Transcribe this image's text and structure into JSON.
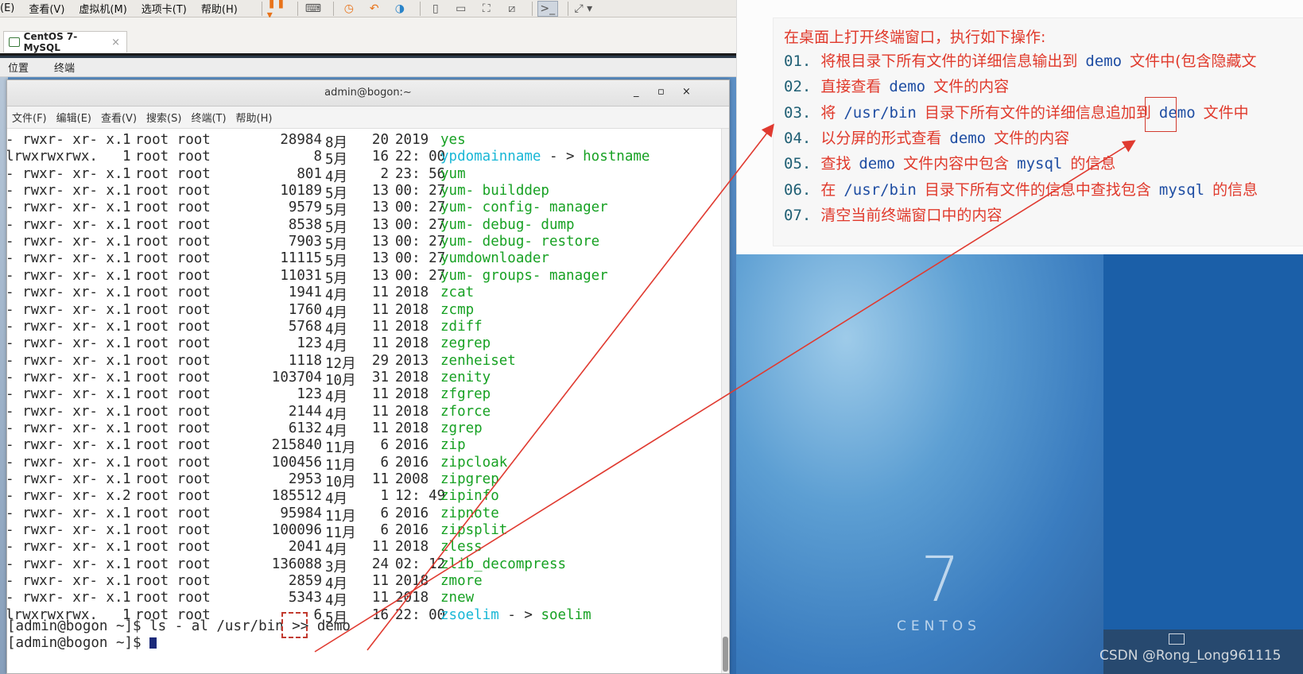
{
  "vmware": {
    "menu": [
      "(E)",
      "查看(V)",
      "虚拟机(M)",
      "选项卡(T)",
      "帮助(H)"
    ],
    "tab_label": "CentOS 7-MySQL",
    "tab_close": "×"
  },
  "guest_panel": {
    "places": "位置",
    "terminal": "终端"
  },
  "terminal": {
    "title": "admin@bogon:~",
    "btn_min": "_",
    "btn_max": "▫",
    "btn_close": "×",
    "menu": [
      "文件(F)",
      "编辑(E)",
      "查看(V)",
      "搜索(S)",
      "终端(T)",
      "帮助(H)"
    ],
    "rows": [
      {
        "perm": "- rwxr- xr- x.",
        "links": "1",
        "owner": "root root",
        "size": "28984",
        "mon": "8月",
        "day": "20",
        "time": "2019",
        "name": "yes",
        "target": "",
        "color": "g"
      },
      {
        "perm": "lrwxrwxrwx.",
        "links": "1",
        "owner": "root root",
        "size": "8",
        "mon": "5月",
        "day": "16",
        "time": "22: 00",
        "name": "ypdomainname",
        "target": "hostname",
        "color": "cy"
      },
      {
        "perm": "- rwxr- xr- x.",
        "links": "1",
        "owner": "root root",
        "size": "801",
        "mon": "4月",
        "day": "2",
        "time": "23: 56",
        "name": "yum",
        "target": "",
        "color": "g"
      },
      {
        "perm": "- rwxr- xr- x.",
        "links": "1",
        "owner": "root root",
        "size": "10189",
        "mon": "5月",
        "day": "13",
        "time": "00: 27",
        "name": "yum- builddep",
        "target": "",
        "color": "g"
      },
      {
        "perm": "- rwxr- xr- x.",
        "links": "1",
        "owner": "root root",
        "size": "9579",
        "mon": "5月",
        "day": "13",
        "time": "00: 27",
        "name": "yum- config- manager",
        "target": "",
        "color": "g"
      },
      {
        "perm": "- rwxr- xr- x.",
        "links": "1",
        "owner": "root root",
        "size": "8538",
        "mon": "5月",
        "day": "13",
        "time": "00: 27",
        "name": "yum- debug- dump",
        "target": "",
        "color": "g"
      },
      {
        "perm": "- rwxr- xr- x.",
        "links": "1",
        "owner": "root root",
        "size": "7903",
        "mon": "5月",
        "day": "13",
        "time": "00: 27",
        "name": "yum- debug- restore",
        "target": "",
        "color": "g"
      },
      {
        "perm": "- rwxr- xr- x.",
        "links": "1",
        "owner": "root root",
        "size": "11115",
        "mon": "5月",
        "day": "13",
        "time": "00: 27",
        "name": "yumdownloader",
        "target": "",
        "color": "g"
      },
      {
        "perm": "- rwxr- xr- x.",
        "links": "1",
        "owner": "root root",
        "size": "11031",
        "mon": "5月",
        "day": "13",
        "time": "00: 27",
        "name": "yum- groups- manager",
        "target": "",
        "color": "g"
      },
      {
        "perm": "- rwxr- xr- x.",
        "links": "1",
        "owner": "root root",
        "size": "1941",
        "mon": "4月",
        "day": "11",
        "time": "2018",
        "name": "zcat",
        "target": "",
        "color": "g"
      },
      {
        "perm": "- rwxr- xr- x.",
        "links": "1",
        "owner": "root root",
        "size": "1760",
        "mon": "4月",
        "day": "11",
        "time": "2018",
        "name": "zcmp",
        "target": "",
        "color": "g"
      },
      {
        "perm": "- rwxr- xr- x.",
        "links": "1",
        "owner": "root root",
        "size": "5768",
        "mon": "4月",
        "day": "11",
        "time": "2018",
        "name": "zdiff",
        "target": "",
        "color": "g"
      },
      {
        "perm": "- rwxr- xr- x.",
        "links": "1",
        "owner": "root root",
        "size": "123",
        "mon": "4月",
        "day": "11",
        "time": "2018",
        "name": "zegrep",
        "target": "",
        "color": "g"
      },
      {
        "perm": "- rwxr- xr- x.",
        "links": "1",
        "owner": "root root",
        "size": "1118",
        "mon": "12月",
        "day": "29",
        "time": "2013",
        "name": "zenheiset",
        "target": "",
        "color": "g"
      },
      {
        "perm": "- rwxr- xr- x.",
        "links": "1",
        "owner": "root root",
        "size": "103704",
        "mon": "10月",
        "day": "31",
        "time": "2018",
        "name": "zenity",
        "target": "",
        "color": "g"
      },
      {
        "perm": "- rwxr- xr- x.",
        "links": "1",
        "owner": "root root",
        "size": "123",
        "mon": "4月",
        "day": "11",
        "time": "2018",
        "name": "zfgrep",
        "target": "",
        "color": "g"
      },
      {
        "perm": "- rwxr- xr- x.",
        "links": "1",
        "owner": "root root",
        "size": "2144",
        "mon": "4月",
        "day": "11",
        "time": "2018",
        "name": "zforce",
        "target": "",
        "color": "g"
      },
      {
        "perm": "- rwxr- xr- x.",
        "links": "1",
        "owner": "root root",
        "size": "6132",
        "mon": "4月",
        "day": "11",
        "time": "2018",
        "name": "zgrep",
        "target": "",
        "color": "g"
      },
      {
        "perm": "- rwxr- xr- x.",
        "links": "1",
        "owner": "root root",
        "size": "215840",
        "mon": "11月",
        "day": "6",
        "time": "2016",
        "name": "zip",
        "target": "",
        "color": "g"
      },
      {
        "perm": "- rwxr- xr- x.",
        "links": "1",
        "owner": "root root",
        "size": "100456",
        "mon": "11月",
        "day": "6",
        "time": "2016",
        "name": "zipcloak",
        "target": "",
        "color": "g"
      },
      {
        "perm": "- rwxr- xr- x.",
        "links": "1",
        "owner": "root root",
        "size": "2953",
        "mon": "10月",
        "day": "11",
        "time": "2008",
        "name": "zipgrep",
        "target": "",
        "color": "g"
      },
      {
        "perm": "- rwxr- xr- x.",
        "links": "2",
        "owner": "root root",
        "size": "185512",
        "mon": "4月",
        "day": "1",
        "time": "12: 49",
        "name": "zipinfo",
        "target": "",
        "color": "g"
      },
      {
        "perm": "- rwxr- xr- x.",
        "links": "1",
        "owner": "root root",
        "size": "95984",
        "mon": "11月",
        "day": "6",
        "time": "2016",
        "name": "zipnote",
        "target": "",
        "color": "g"
      },
      {
        "perm": "- rwxr- xr- x.",
        "links": "1",
        "owner": "root root",
        "size": "100096",
        "mon": "11月",
        "day": "6",
        "time": "2016",
        "name": "zipsplit",
        "target": "",
        "color": "g"
      },
      {
        "perm": "- rwxr- xr- x.",
        "links": "1",
        "owner": "root root",
        "size": "2041",
        "mon": "4月",
        "day": "11",
        "time": "2018",
        "name": "zless",
        "target": "",
        "color": "g"
      },
      {
        "perm": "- rwxr- xr- x.",
        "links": "1",
        "owner": "root root",
        "size": "136088",
        "mon": "3月",
        "day": "24",
        "time": "02: 12",
        "name": "zlib_decompress",
        "target": "",
        "color": "g"
      },
      {
        "perm": "- rwxr- xr- x.",
        "links": "1",
        "owner": "root root",
        "size": "2859",
        "mon": "4月",
        "day": "11",
        "time": "2018",
        "name": "zmore",
        "target": "",
        "color": "g"
      },
      {
        "perm": "- rwxr- xr- x.",
        "links": "1",
        "owner": "root root",
        "size": "5343",
        "mon": "4月",
        "day": "11",
        "time": "2018",
        "name": "znew",
        "target": "",
        "color": "g"
      },
      {
        "perm": "lrwxrwxrwx.",
        "links": "1",
        "owner": "root root",
        "size": "6",
        "mon": "5月",
        "day": "16",
        "time": "22: 00",
        "name": "zsoelim",
        "target": "soelim",
        "color": "cy"
      }
    ],
    "arrow_sep": "- >",
    "prompt_line": "[admin@bogon ~]$ ls - al /usr/bin >> demo",
    "prompt2": "[admin@bogon ~]$ "
  },
  "slide": {
    "heading": "在桌面上打开终端窗口，执行如下操作:",
    "items": [
      {
        "num": "01.",
        "parts": [
          "将根目录下所有文件的详细信息输出到",
          "demo",
          "文件中(包含隐藏文"
        ]
      },
      {
        "num": "02.",
        "parts": [
          "直接查看",
          "demo",
          "文件的内容"
        ]
      },
      {
        "num": "03.",
        "parts": [
          "将",
          "/usr/bin",
          "目录下所有文件的详细信息追加到",
          "demo",
          "文件中"
        ]
      },
      {
        "num": "04.",
        "parts": [
          "以分屏的形式查看",
          "demo",
          "文件的内容"
        ]
      },
      {
        "num": "05.",
        "parts": [
          "查找",
          "demo",
          "文件内容中包含",
          "mysql",
          "的信息"
        ]
      },
      {
        "num": "06.",
        "parts": [
          "在",
          "/usr/bin",
          "目录下所有文件的信息中查找包含",
          "mysql",
          "的信息"
        ]
      },
      {
        "num": "07.",
        "parts": [
          "清空当前终端窗口中的内容"
        ]
      }
    ]
  },
  "desktop": {
    "logo_number": "7",
    "logo_word": "CENTOS"
  },
  "watermark": "CSDN @Rong_Long961115",
  "colors": {
    "green": "#17a123",
    "cyan": "#18b7d6",
    "slide_red": "#e0392b",
    "slide_code": "#1f4ea3",
    "arrow": "#e03a30"
  }
}
